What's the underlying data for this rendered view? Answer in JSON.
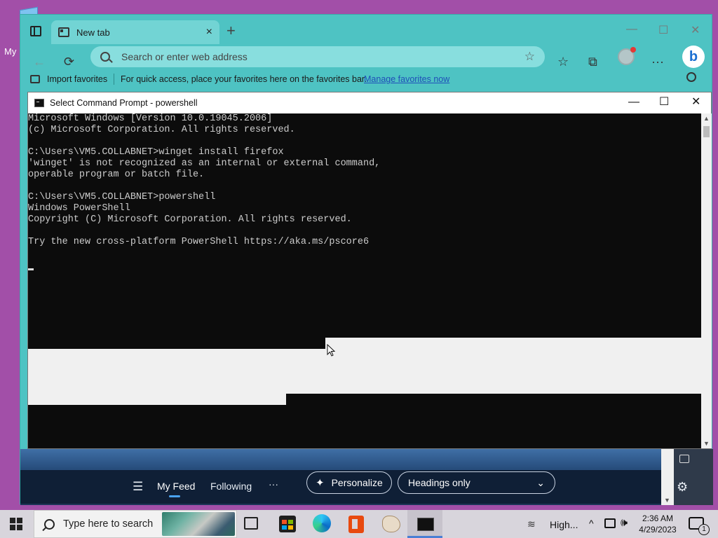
{
  "desktop": {
    "icon_label": "My"
  },
  "browser": {
    "tab_title": "New tab",
    "tab_close": "×",
    "new_tab": "+",
    "window_controls": {
      "minimize": "—",
      "maximize": "☐",
      "close": "✕"
    },
    "toolbar": {
      "back": "←",
      "refresh": "⟳",
      "favorites": "☆",
      "collections": "⧉",
      "more": "···",
      "bing": "b"
    },
    "address_placeholder": "Search or enter web address",
    "add_favorite": "☆",
    "favbar": {
      "import_label": "Import favorites",
      "hint": "For quick access, place your favorites here on the favorites bar.",
      "manage_link": "Manage favorites now"
    },
    "feed": {
      "menu": "☰",
      "my_feed": "My Feed",
      "following": "Following",
      "more": "···",
      "personalize": "Personalize",
      "personalize_icon": "✦",
      "headings": "Headings only",
      "dropdown_chevron": "⌄",
      "settings": "⚙"
    }
  },
  "cmd": {
    "title": "Select Command Prompt - powershell",
    "controls": {
      "minimize": "—",
      "maximize": "☐",
      "close": "✕"
    },
    "lines": [
      "Microsoft Windows [Version 10.0.19045.2006]",
      "(c) Microsoft Corporation. All rights reserved.",
      "",
      "C:\\Users\\VM5.COLLABNET>winget install firefox",
      "'winget' is not recognized as an internal or external command,",
      "operable program or batch file.",
      "",
      "C:\\Users\\VM5.COLLABNET>powershell",
      "Windows PowerShell",
      "Copyright (C) Microsoft Corporation. All rights reserved.",
      "",
      "Try the new cross-platform PowerShell https://aka.ms/pscore6",
      ""
    ],
    "scroll_up": "▲",
    "scroll_down": "▼"
  },
  "taskbar": {
    "search_placeholder": "Type here to search",
    "weather_text": "High...",
    "wind_glyph": "≋",
    "tray_chevron": "^",
    "volume_glyph": "🕪",
    "time": "2:36 AM",
    "date": "4/29/2023",
    "notifications_count": "1"
  },
  "colors": {
    "desktop_bg": "#a24fa8",
    "browser_teal": "#4ec3c3",
    "console_bg": "#0c0c0c",
    "console_fg": "#cccccc",
    "link_blue": "#1f4fb8"
  }
}
